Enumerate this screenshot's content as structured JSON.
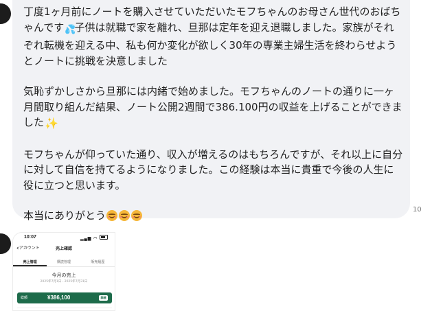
{
  "message": {
    "paragraphs": [
      {
        "before_emoji": "丁度1ヶ月前にノートを購入させていただいたモフちゃんのお母さん世代のおばちゃんです",
        "emoji": "sweat-droplets",
        "after_emoji": "子供は就職で家を離れ、旦那は定年を迎え退職しました。家族がそれぞれ転機を迎える中、私も何か変化が欲しく30年の専業主婦生活を終わらせようとノートに挑戦を決意しました"
      },
      {
        "before_emoji": "気恥ずかしさから旦那には内緒で始めました。モフちゃんのノートの通りに一ヶ月間取り組んだ結果、ノート公開2週間で386.100円の収益を上げることができました",
        "emoji": "sparkles"
      },
      {
        "text": "モフちゃんが仰っていた通り、収入が増えるのはもちろんですが、それ以上に自分に対して自信を持てるようになりました。この経験は本当に貴重で今後の人生に役に立つと思います。"
      },
      {
        "before_emoji": "本当にありがとう",
        "emoji": "smiling-face-with-smiling-eyes x3"
      }
    ],
    "side_number": "10"
  },
  "screenshot": {
    "status_time": "10:07",
    "back_label": "アカウント",
    "title": "売上確認",
    "tabs": [
      "売上管理",
      "購読管理",
      "販売履歴"
    ],
    "active_tab": "売上管理",
    "sales_heading": "今月の売上",
    "date_range": "2025年7月1日 - 2025年7月31日",
    "bar_label": "総額",
    "amount": "¥386,100",
    "bar_button": "詳細",
    "colors": {
      "bar": "#1d6b4a"
    }
  }
}
